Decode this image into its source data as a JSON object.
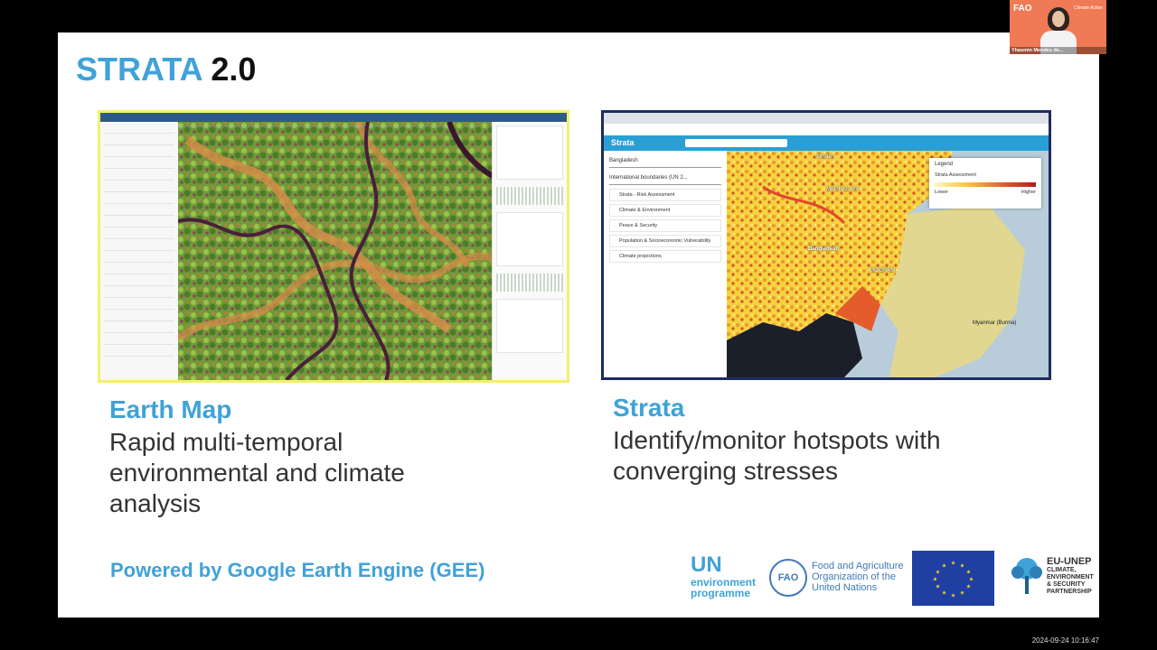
{
  "slide": {
    "title_brand": "STRATA",
    "title_version": "2.0",
    "left": {
      "heading": "Earth Map",
      "body": [
        "Rapid multi-temporal",
        "environmental and climate",
        "analysis"
      ]
    },
    "right": {
      "heading": "Strata",
      "body": [
        "Identify/monitor hotspots with",
        "converging stresses"
      ]
    },
    "footer": "Powered by Google Earth Engine (GEE)"
  },
  "strata_screenshot": {
    "logo": "Strata",
    "country": "Bangladesh",
    "boundaries": "International boundaries (UN 2...",
    "menu": [
      "Strata - Risk Assessment",
      "Climate & Environment",
      "Peace & Security",
      "Population & Socioeconomic Vulnerability",
      "Climate projections"
    ],
    "legend_title": "Legend",
    "legend_layer": "Strata Assessment",
    "legend_low": "Lower",
    "legend_high": "Higher",
    "labels": {
      "bangladesh": "Bangladesh",
      "myanmar": "Myanmar (Burma)",
      "bhutan": "Bhutan",
      "meghalaya": "MEGHALAYA",
      "mizoram": "MIZORAM"
    }
  },
  "logos": {
    "unep_un": "UN",
    "unep_sub1": "environment",
    "unep_sub2": "programme",
    "fao_name": [
      "Food and Agriculture",
      "Organization of the",
      "United Nations"
    ],
    "partnership": [
      "EU-UNEP",
      "CLIMATE,",
      "ENVIRONMENT",
      "& SECURITY",
      "PARTNERSHIP"
    ]
  },
  "video": {
    "org": "FAO",
    "tag": "Climate Action",
    "name": "Yhasmin Mendes de..."
  },
  "timestamp": "2024-09-24 10:16:47",
  "colors": {
    "accent": "#3fa2d8",
    "earth_border": "#f4f06a",
    "strata_border": "#1d2c63"
  }
}
